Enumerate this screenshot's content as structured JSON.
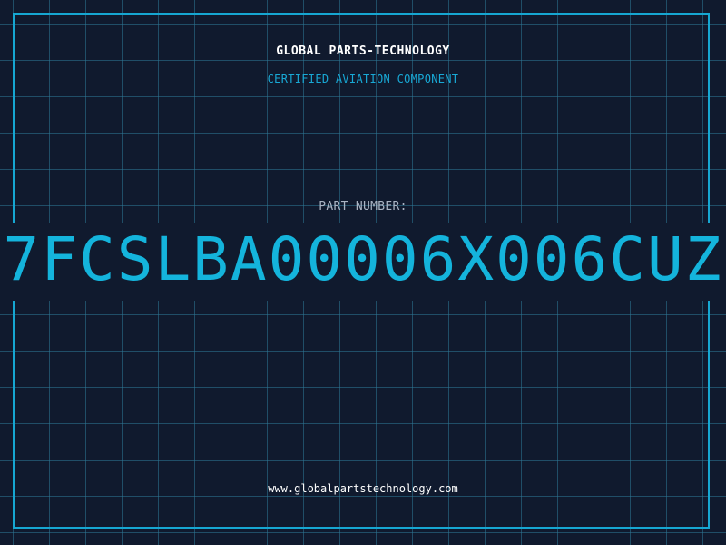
{
  "header": {
    "company_name": "GLOBAL PARTS-TECHNOLOGY",
    "subtitle": "CERTIFIED AVIATION COMPONENT"
  },
  "part": {
    "label": "PART NUMBER:",
    "number": "7FCSLBA00006X006CUZ"
  },
  "footer": {
    "website": "www.globalpartstechnology.com"
  },
  "colors": {
    "background": "#101a2e",
    "accent": "#14b4dc",
    "grid": "#2e7896",
    "text_primary": "#ffffff",
    "text_muted": "#a9b4c4"
  }
}
